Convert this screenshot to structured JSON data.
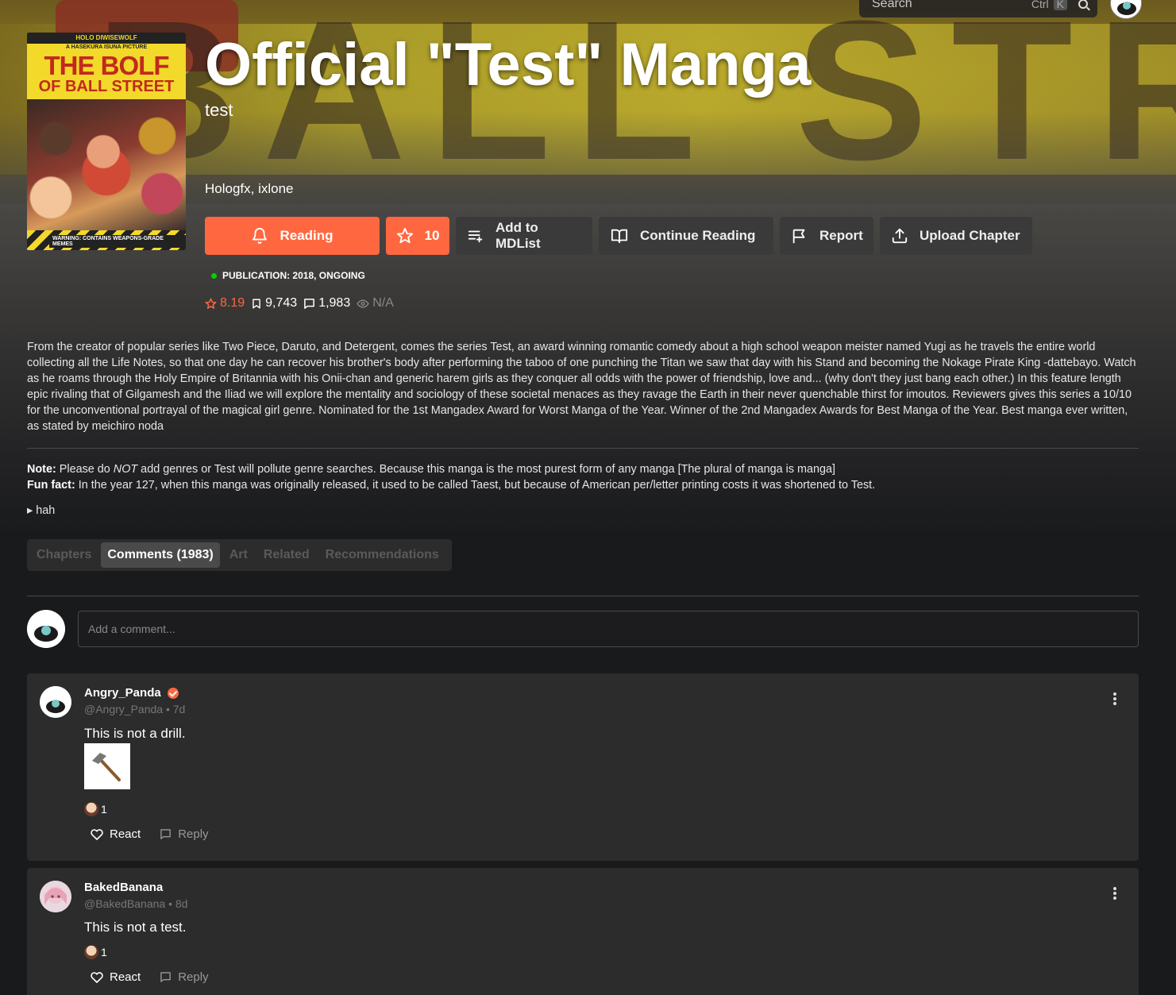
{
  "search": {
    "placeholder": "Search",
    "kbd_ctrl": "Ctrl",
    "kbd_k": "K"
  },
  "manga": {
    "title": "Official \"Test\" Manga",
    "alt_title": "test",
    "authors": "Hologfx, ixlone",
    "cover": {
      "publisher_line": "HOLO DIWISEWOLF",
      "sub_line": "A HASEKURA ISUNA PICTURE",
      "title_line1": "THE BOLF",
      "title_line2": "OF BALL STREET",
      "warning": "WARNING: CONTAINS WEAPONS-GRADE MEMES"
    }
  },
  "actions": {
    "reading": "Reading",
    "follows": "10",
    "add_to_list": "Add to MDList",
    "continue": "Continue Reading",
    "report": "Report",
    "upload": "Upload Chapter"
  },
  "publication": "PUBLICATION: 2018, ONGOING",
  "stats": {
    "rating": "8.19",
    "follows": "9,743",
    "comments": "1,983",
    "views": "N/A"
  },
  "description": "From the creator of popular series like Two Piece, Daruto, and Detergent, comes the series Test, an award winning romantic comedy about a high school weapon meister named Yugi as he travels the entire world collecting all the Life Notes, so that one day he can recover his brother's body after performing the taboo of one punching the Titan we saw that day with his Stand and becoming the Nokage Pirate King -dattebayo. Watch as he roams through the Holy Empire of Britannia with his Onii-chan and generic harem girls as they conquer all odds with the power of friendship, love and... (why don't they just bang each other.) In this feature length epic rivaling that of Gilgamesh and the Iliad we will explore the mentality and sociology of these societal menaces as they ravage the Earth in their never quenchable thirst for imoutos. Reviewers gives this series a 10/10 for the unconventional portrayal of the magical girl genre. Nominated for the 1st Mangadex Award for Worst Manga of the Year. Winner of the 2nd Mangadex Awards for Best Manga of the Year. Best manga ever written, as stated by meichiro noda",
  "note": {
    "label": "Note:",
    "text_before": " Please do ",
    "emphasis": "NOT",
    "text_after": " add genres or Test will pollute genre searches. Because this manga is the most purest form of any manga [The plural of manga is manga]",
    "fun_label": "Fun fact:",
    "fun_text": " In the year 127, when this manga was originally released, it used to be called Taest, but because of American per/letter printing costs it was shortened to Test."
  },
  "spoiler": "▸ hah",
  "tabs": [
    "Chapters",
    "Comments (1983)",
    "Art",
    "Related",
    "Recommendations"
  ],
  "comment_input": {
    "placeholder": "Add a comment..."
  },
  "comments": [
    {
      "name": "Angry_Panda",
      "handle": "@Angry_Panda",
      "time": "7d",
      "text": "This is not a drill.",
      "reactions": "1",
      "react": "React",
      "reply": "Reply"
    },
    {
      "name": "BakedBanana",
      "handle": "@BakedBanana",
      "time": "8d",
      "text": "This is not a test.",
      "reactions": "1",
      "react": "React",
      "reply": "Reply"
    }
  ],
  "colors": {
    "accent": "#ff6740",
    "status_green": "#04d000",
    "background": "#191a1c",
    "card": "#2c2c2c"
  }
}
